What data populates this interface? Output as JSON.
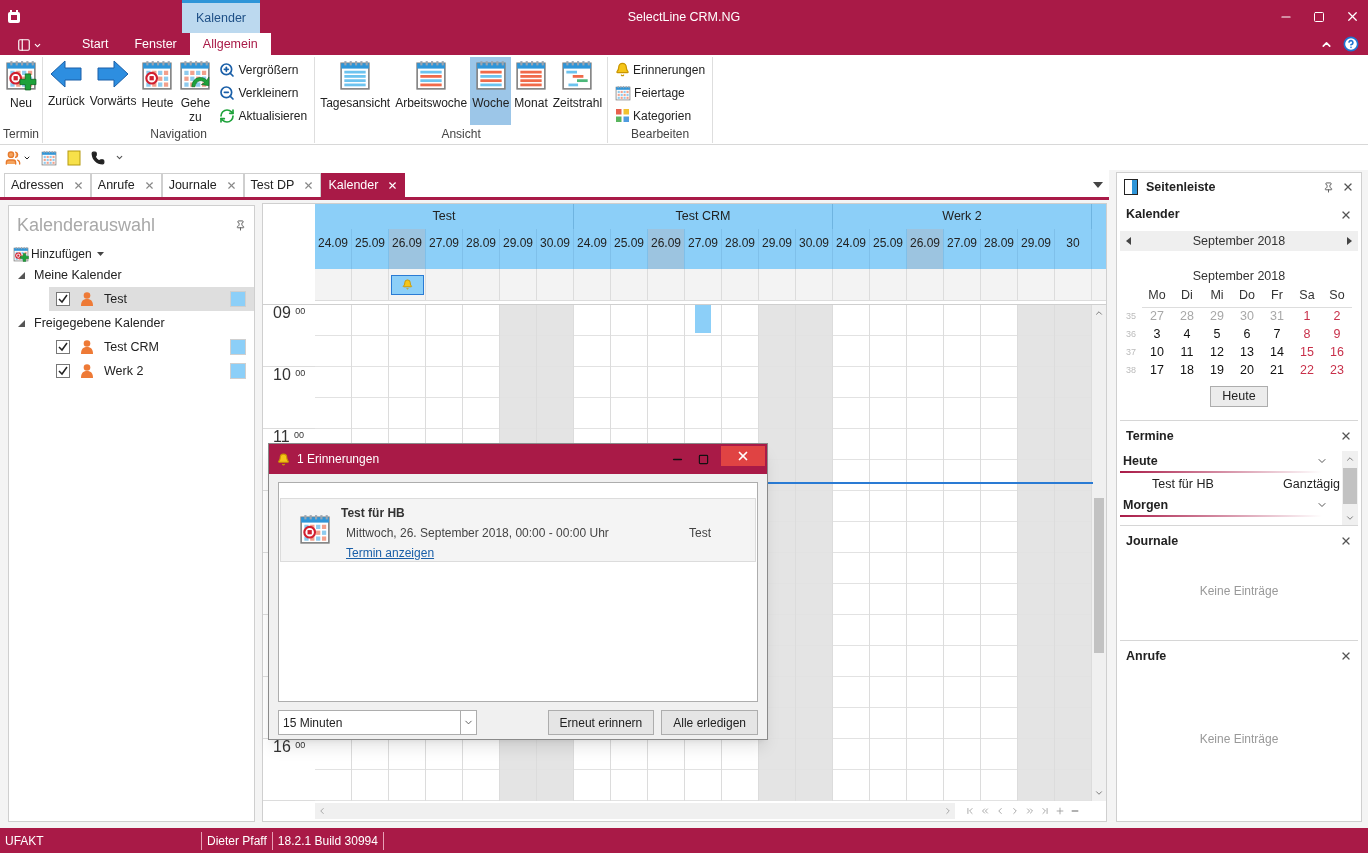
{
  "window": {
    "title": "SelectLine CRM.NG",
    "context_tab": "Kalender"
  },
  "ribbon_tabs": [
    {
      "label": "Start",
      "selected": false
    },
    {
      "label": "Fenster",
      "selected": false
    },
    {
      "label": "Allgemein",
      "selected": true
    }
  ],
  "ribbon_groups": [
    {
      "label": "Termin",
      "large": [
        {
          "label": "Neu"
        }
      ]
    },
    {
      "label": "Navigation",
      "large": [
        {
          "label": "Zurück"
        },
        {
          "label": "Vorwärts"
        },
        {
          "label": "Heute"
        },
        {
          "label": "Gehe zu"
        }
      ],
      "small": [
        {
          "label": "Vergrößern"
        },
        {
          "label": "Verkleinern"
        },
        {
          "label": "Aktualisieren"
        }
      ]
    },
    {
      "label": "Ansicht",
      "large": [
        {
          "label": "Tagesansicht",
          "selected": false
        },
        {
          "label": "Arbeitswoche",
          "selected": false
        },
        {
          "label": "Woche",
          "selected": true
        },
        {
          "label": "Monat",
          "selected": false
        },
        {
          "label": "Zeitstrahl",
          "selected": false
        }
      ]
    },
    {
      "label": "Bearbeiten",
      "small": [
        {
          "label": "Erinnerungen"
        },
        {
          "label": "Feiertage"
        },
        {
          "label": "Kategorien"
        }
      ]
    }
  ],
  "document_tabs": [
    {
      "label": "Adressen",
      "selected": false
    },
    {
      "label": "Anrufe",
      "selected": false
    },
    {
      "label": "Journale",
      "selected": false
    },
    {
      "label": "Test DP",
      "selected": false
    },
    {
      "label": "Kalender",
      "selected": true
    }
  ],
  "calendar_selection": {
    "title": "Kalenderauswahl",
    "add_button": "Hinzufügen",
    "groups": [
      {
        "label": "Meine Kalender",
        "expanded": true,
        "children": [
          {
            "label": "Test",
            "checked": true,
            "selected": true,
            "color": "#8ccff8"
          }
        ]
      },
      {
        "label": "Freigegebene Kalender",
        "expanded": true,
        "children": [
          {
            "label": "Test CRM",
            "checked": true,
            "selected": false,
            "color": "#8ccff8"
          },
          {
            "label": "Werk 2",
            "checked": true,
            "selected": false,
            "color": "#8ccff8"
          }
        ]
      }
    ]
  },
  "calendars": [
    {
      "name": "Test",
      "days": [
        {
          "label": "24.09",
          "selected": false,
          "weekend": false
        },
        {
          "label": "25.09",
          "selected": false,
          "weekend": false
        },
        {
          "label": "26.09",
          "selected": true,
          "weekend": false,
          "event": {
            "kind": "reminder"
          }
        },
        {
          "label": "27.09",
          "selected": false,
          "weekend": false
        },
        {
          "label": "28.09",
          "selected": false,
          "weekend": false
        },
        {
          "label": "29.09",
          "selected": false,
          "weekend": true
        },
        {
          "label": "30.09",
          "selected": false,
          "weekend": true
        }
      ]
    },
    {
      "name": "Test CRM",
      "days": [
        {
          "label": "24.09",
          "selected": false,
          "weekend": false
        },
        {
          "label": "25.09",
          "selected": false,
          "weekend": false
        },
        {
          "label": "26.09",
          "selected": true,
          "weekend": false
        },
        {
          "label": "27.09",
          "selected": false,
          "weekend": false,
          "event": {
            "kind": "appointment"
          }
        },
        {
          "label": "28.09",
          "selected": false,
          "weekend": false
        },
        {
          "label": "29.09",
          "selected": false,
          "weekend": true
        },
        {
          "label": "30.09",
          "selected": false,
          "weekend": true
        }
      ]
    },
    {
      "name": "Werk 2",
      "days": [
        {
          "label": "24.09",
          "selected": false,
          "weekend": false
        },
        {
          "label": "25.09",
          "selected": false,
          "weekend": false
        },
        {
          "label": "26.09",
          "selected": true,
          "weekend": false
        },
        {
          "label": "27.09",
          "selected": false,
          "weekend": false
        },
        {
          "label": "28.09",
          "selected": false,
          "weekend": false
        },
        {
          "label": "29.09",
          "selected": false,
          "weekend": true
        },
        {
          "label": "30",
          "selected": false,
          "weekend": true
        }
      ]
    }
  ],
  "time_labels": [
    {
      "hour": "09",
      "minutes": "00"
    },
    {
      "hour": "10",
      "minutes": "00"
    },
    {
      "hour": "11",
      "minutes": "00"
    },
    {
      "hour": "16",
      "minutes": "00"
    }
  ],
  "reminder_dialog": {
    "title": "1 Erinnerungen",
    "items": [
      {
        "subject": "Test für HB",
        "when": "Mittwoch, 26. September 2018, 00:00 - 00:00 Uhr",
        "calendar": "Test",
        "link": "Termin anzeigen"
      }
    ],
    "snooze": "15 Minuten",
    "buttons": [
      "Erneut erinnern",
      "Alle erledigen"
    ]
  },
  "sidebar": {
    "title": "Seitenleiste",
    "calendar": {
      "title": "Kalender",
      "nav_month": "September 2018",
      "month": "September 2018",
      "weekdays": [
        "Mo",
        "Di",
        "Mi",
        "Do",
        "Fr",
        "Sa",
        "So"
      ],
      "weeks": [
        {
          "number": "35",
          "days": [
            {
              "label": "27",
              "kind": "outside"
            },
            {
              "label": "28",
              "kind": "outside"
            },
            {
              "label": "29",
              "kind": "outside"
            },
            {
              "label": "30",
              "kind": "outside"
            },
            {
              "label": "31",
              "kind": "outside"
            },
            {
              "label": "1",
              "kind": "weekend"
            },
            {
              "label": "2",
              "kind": "weekend"
            }
          ]
        },
        {
          "number": "36",
          "days": [
            {
              "label": "3",
              "kind": "day"
            },
            {
              "label": "4",
              "kind": "day"
            },
            {
              "label": "5",
              "kind": "day"
            },
            {
              "label": "6",
              "kind": "day"
            },
            {
              "label": "7",
              "kind": "day"
            },
            {
              "label": "8",
              "kind": "weekend"
            },
            {
              "label": "9",
              "kind": "weekend"
            }
          ]
        },
        {
          "number": "37",
          "days": [
            {
              "label": "10",
              "kind": "day"
            },
            {
              "label": "11",
              "kind": "day"
            },
            {
              "label": "12",
              "kind": "day"
            },
            {
              "label": "13",
              "kind": "day"
            },
            {
              "label": "14",
              "kind": "day"
            },
            {
              "label": "15",
              "kind": "weekend"
            },
            {
              "label": "16",
              "kind": "weekend"
            }
          ]
        },
        {
          "number": "38",
          "days": [
            {
              "label": "17",
              "kind": "day"
            },
            {
              "label": "18",
              "kind": "day"
            },
            {
              "label": "19",
              "kind": "day"
            },
            {
              "label": "20",
              "kind": "day"
            },
            {
              "label": "21",
              "kind": "day"
            },
            {
              "label": "22",
              "kind": "weekend"
            },
            {
              "label": "23",
              "kind": "weekend"
            }
          ]
        }
      ],
      "today_button": "Heute"
    },
    "appointments": {
      "title": "Termine",
      "groups": [
        {
          "label": "Heute",
          "items": [
            {
              "subject": "Test für HB",
              "time": "Ganztägig"
            }
          ]
        },
        {
          "label": "Morgen"
        }
      ]
    },
    "journals": {
      "title": "Journale",
      "empty_text": "Keine Einträge"
    },
    "calls": {
      "title": "Anrufe",
      "empty_text": "Keine Einträge"
    }
  },
  "status_bar": [
    "UFAKT",
    "Dieter Pfaff",
    "18.2.1 Build 30994"
  ]
}
